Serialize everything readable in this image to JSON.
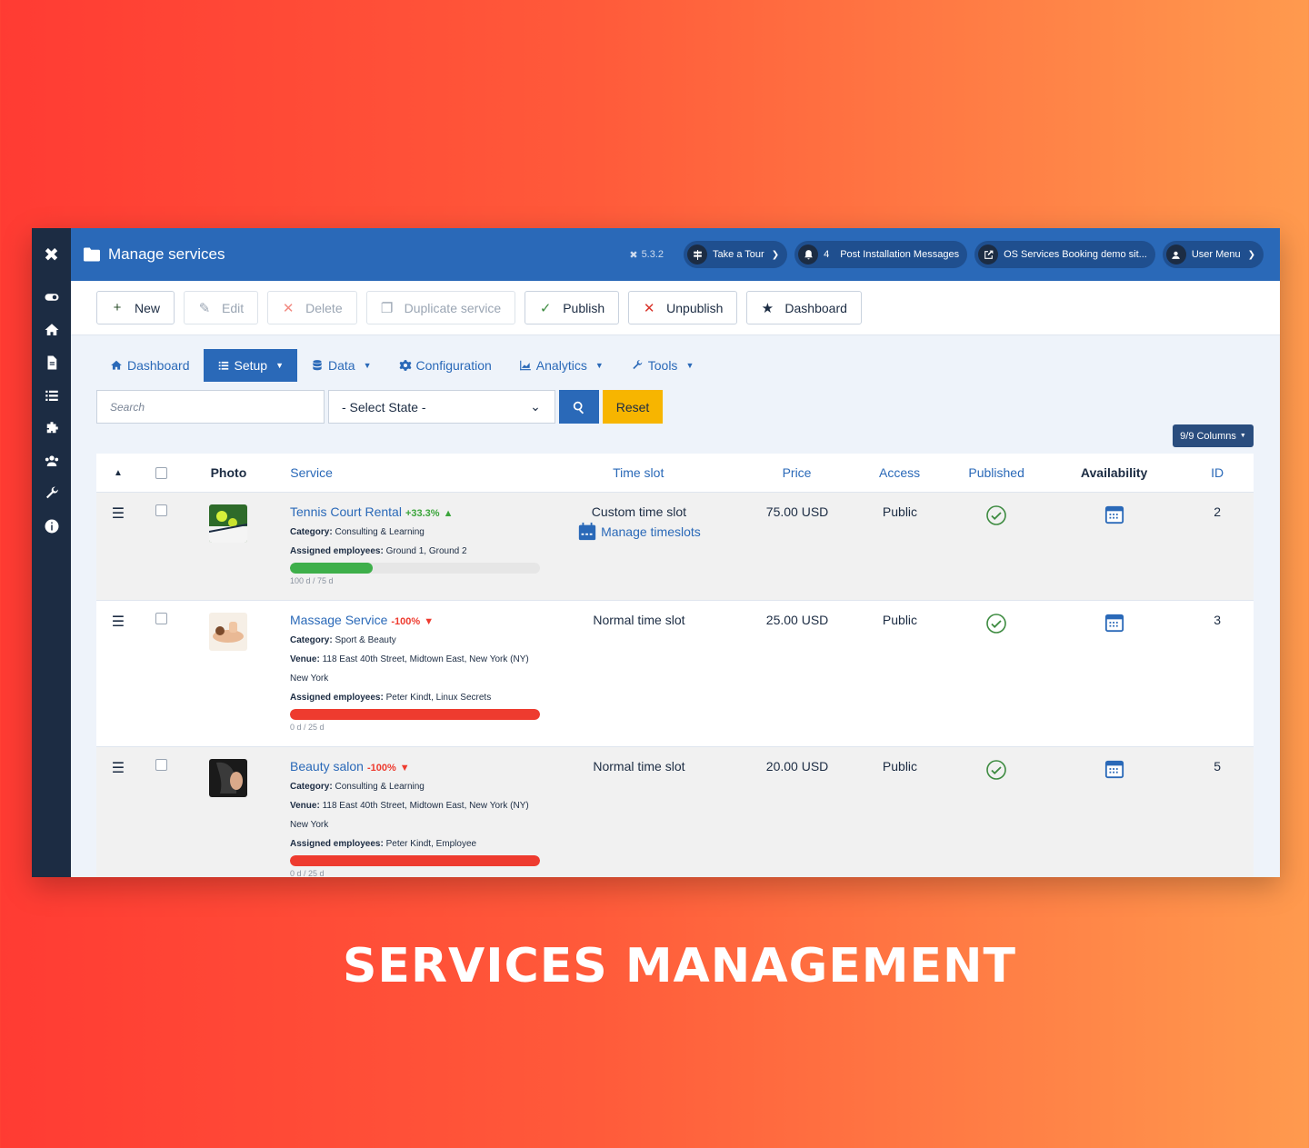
{
  "app": {
    "page_title": "Manage services",
    "version": "5.3.2"
  },
  "header_pills": {
    "tour": "Take a Tour",
    "notif_count": "4",
    "notif_label": "Post Installation Messages",
    "site": "OS Services Booking demo sit...",
    "user": "User Menu"
  },
  "toolbar": {
    "new": "New",
    "edit": "Edit",
    "delete": "Delete",
    "duplicate": "Duplicate service",
    "publish": "Publish",
    "unpublish": "Unpublish",
    "dashboard": "Dashboard"
  },
  "subnav": {
    "dashboard": "Dashboard",
    "setup": "Setup",
    "data": "Data",
    "configuration": "Configuration",
    "analytics": "Analytics",
    "tools": "Tools"
  },
  "filters": {
    "search_placeholder": "Search",
    "state_selected": "- Select State -",
    "reset": "Reset"
  },
  "columns_button": "9/9 Columns",
  "table": {
    "headers": {
      "photo": "Photo",
      "service": "Service",
      "time_slot": "Time slot",
      "price": "Price",
      "access": "Access",
      "published": "Published",
      "availability": "Availability",
      "id": "ID"
    },
    "rows": [
      {
        "name": "Tennis Court Rental",
        "pct": "+33.3%",
        "trend": "up",
        "category_label": "Category:",
        "category": "Consulting & Learning",
        "venue_label": "",
        "venue": "",
        "city": "",
        "employees_label": "Assigned employees:",
        "employees": "Ground 1, Ground 2",
        "progress": 0.33,
        "progress_color": "#3eaf4a",
        "progress_label": "100 d / 75 d",
        "time_slot": "Custom time slot",
        "manage_link": "Manage timeslots",
        "price": "75.00 USD",
        "access": "Public",
        "id": "2"
      },
      {
        "name": "Massage Service",
        "pct": "-100%",
        "trend": "down",
        "category_label": "Category:",
        "category": "Sport & Beauty",
        "venue_label": "Venue:",
        "venue": "118 East 40th Street, Midtown East, New York (NY)",
        "city": "New York",
        "employees_label": "Assigned employees:",
        "employees": "Peter Kindt, Linux Secrets",
        "progress": 1.0,
        "progress_color": "#ee3b2f",
        "progress_label": "0 d / 25 d",
        "time_slot": "Normal time slot",
        "manage_link": "",
        "price": "25.00 USD",
        "access": "Public",
        "id": "3"
      },
      {
        "name": "Beauty salon",
        "pct": "-100%",
        "trend": "down",
        "category_label": "Category:",
        "category": "Consulting & Learning",
        "venue_label": "Venue:",
        "venue": "118 East 40th Street, Midtown East, New York (NY)",
        "city": "New York",
        "employees_label": "Assigned employees:",
        "employees": "Peter Kindt, Employee",
        "progress": 1.0,
        "progress_color": "#ee3b2f",
        "progress_label": "0 d / 25 d",
        "time_slot": "Normal time slot",
        "manage_link": "",
        "price": "20.00 USD",
        "access": "Public",
        "id": "5"
      }
    ]
  },
  "banner": "SERVICES MANAGEMENT",
  "colors": {
    "primary": "#2a69b8",
    "sidebar": "#1c2c43",
    "reset": "#f7b500",
    "published_green": "#3d8b40"
  }
}
